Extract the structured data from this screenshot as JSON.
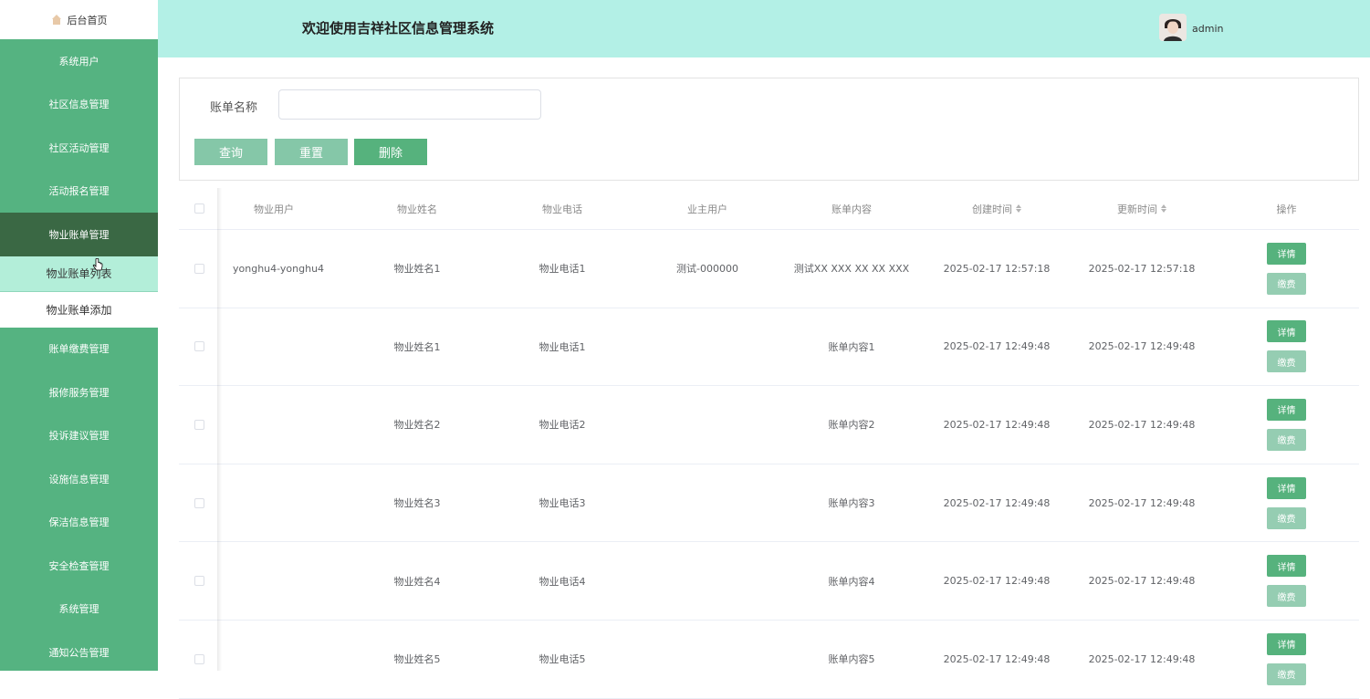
{
  "app": {
    "title": "欢迎使用吉祥社区信息管理系统",
    "user": "admin"
  },
  "sidebar": {
    "home": "后台首页",
    "items": [
      {
        "label": "系统用户"
      },
      {
        "label": "社区信息管理"
      },
      {
        "label": "社区活动管理"
      },
      {
        "label": "活动报名管理"
      },
      {
        "label": "物业账单管理",
        "active": true
      },
      {
        "label": "账单缴费管理"
      },
      {
        "label": "报修服务管理"
      },
      {
        "label": "投诉建议管理"
      },
      {
        "label": "设施信息管理"
      },
      {
        "label": "保洁信息管理"
      },
      {
        "label": "安全检查管理"
      },
      {
        "label": "系统管理"
      },
      {
        "label": "通知公告管理"
      }
    ],
    "subitems": [
      {
        "label": "物业账单列表",
        "active": true
      },
      {
        "label": "物业账单添加"
      }
    ]
  },
  "search": {
    "label": "账单名称",
    "value": "",
    "placeholder": "",
    "buttons": {
      "query": "查询",
      "reset": "重置",
      "delete": "删除"
    }
  },
  "table": {
    "columns": [
      "物业用户",
      "物业姓名",
      "物业电话",
      "业主用户",
      "账单内容",
      "创建时间",
      "更新时间",
      "操作"
    ],
    "sortable": [
      "创建时间",
      "更新时间"
    ],
    "rows": [
      {
        "user": "yonghu4-yonghu4",
        "name": "物业姓名1",
        "phone": "物业电话1",
        "owner": "测试-000000",
        "content": "测试XX XXX XX XX XXX",
        "created": "2025-02-17 12:57:18",
        "updated": "2025-02-17 12:57:18"
      },
      {
        "user": "",
        "name": "物业姓名1",
        "phone": "物业电话1",
        "owner": "",
        "content": "账单内容1",
        "created": "2025-02-17 12:49:48",
        "updated": "2025-02-17 12:49:48"
      },
      {
        "user": "",
        "name": "物业姓名2",
        "phone": "物业电话2",
        "owner": "",
        "content": "账单内容2",
        "created": "2025-02-17 12:49:48",
        "updated": "2025-02-17 12:49:48"
      },
      {
        "user": "",
        "name": "物业姓名3",
        "phone": "物业电话3",
        "owner": "",
        "content": "账单内容3",
        "created": "2025-02-17 12:49:48",
        "updated": "2025-02-17 12:49:48"
      },
      {
        "user": "",
        "name": "物业姓名4",
        "phone": "物业电话4",
        "owner": "",
        "content": "账单内容4",
        "created": "2025-02-17 12:49:48",
        "updated": "2025-02-17 12:49:48"
      },
      {
        "user": "",
        "name": "物业姓名5",
        "phone": "物业电话5",
        "owner": "",
        "content": "账单内容5",
        "created": "2025-02-17 12:49:48",
        "updated": "2025-02-17 12:49:48"
      }
    ],
    "row_actions": {
      "detail": "详情",
      "pay": "缴费"
    }
  },
  "colors": {
    "sidebar_bg": "#55b381",
    "sidebar_active": "#3a6844",
    "header_bg": "#b3f0e6",
    "primary_button": "#56b27d",
    "secondary_button": "#85c7a8"
  }
}
